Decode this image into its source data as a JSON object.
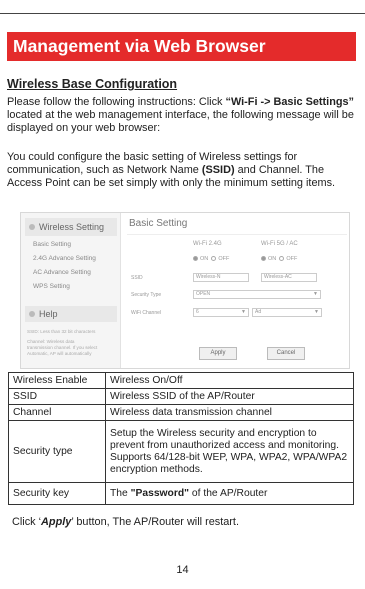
{
  "banner": {
    "title": "Management via Web Browser"
  },
  "section": {
    "title": "Wireless Base Configuration"
  },
  "intro": {
    "p1_a": "Please follow the following instructions: Click ",
    "p1_b": "“Wi-Fi -> Basic Settings”",
    "p1_c": " located at the web management interface, the following message will be displayed on your web browser:",
    "p2_a": "You could configure the basic setting of Wireless settings for communication, such as Network Name ",
    "p2_b": "(SSID)",
    "p2_c": " and Channel. The Access Point can be set simply with only the minimum setting items."
  },
  "screenshot": {
    "sidebar_heading": "Wireless Setting",
    "sidebar_items": [
      "Basic Setting",
      "2.4G Advance Setting",
      "AC Advance Setting",
      "WPS Setting"
    ],
    "help_heading": "Help",
    "help_notes": [
      "SSID: Less than 32 bit characters",
      "Channel: Wireless data",
      "transmission channel. If you select",
      "Automatic, AP will automatically"
    ],
    "main_title": "Basic Setting",
    "col_24": "Wi-Fi 2.4G",
    "col_5": "Wi-Fi 5G / AC",
    "radio_on": "ON",
    "radio_off": "OFF",
    "label_ssid": "SSID",
    "label_security": "Security Type",
    "label_channel": "WiFi Channel",
    "ssid_24": "Wireless-N",
    "ssid_5": "Wireless-AC",
    "security_value": "OPEN",
    "channel_24": "6",
    "channel_5": "Ad",
    "apply": "Apply",
    "cancel": "Cancel"
  },
  "table": [
    {
      "key": "Wireless Enable",
      "value": "Wireless On/Off"
    },
    {
      "key": "SSID",
      "value": "Wireless SSID of the AP/Router"
    },
    {
      "key": "Channel",
      "value": "Wireless data transmission channel"
    },
    {
      "key": "Security type",
      "value": "Setup the Wireless security and encryption to prevent from unauthorized access and monitoring. Supports 64/128-bit WEP, WPA, WPA2, WPA/WPA2 encryption methods."
    },
    {
      "key": "Security key",
      "value_a": "The ",
      "value_b": "\"Password\"",
      "value_c": " of the AP/Router"
    }
  ],
  "footer": {
    "a": "Click ‘",
    "b": "Apply",
    "c": "’ button, The AP/Router will restart."
  },
  "page_number": "14"
}
